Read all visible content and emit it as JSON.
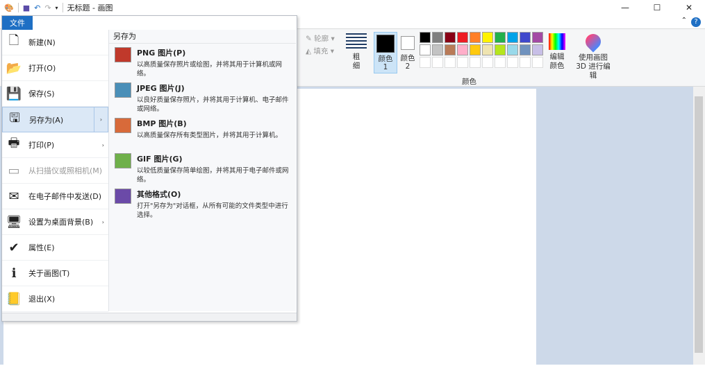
{
  "title": "无标题 - 画图",
  "file_tab": "文件",
  "left_menu": [
    {
      "label": "新建(N)",
      "icon": "new-file-icon",
      "glyph": "🗋"
    },
    {
      "label": "打开(O)",
      "icon": "open-folder-icon",
      "glyph": "📂"
    },
    {
      "label": "保存(S)",
      "icon": "save-icon",
      "glyph": "💾"
    },
    {
      "label": "另存为(A)",
      "icon": "save-as-icon",
      "glyph": "🖫",
      "arrow": "›"
    },
    {
      "label": "打印(P)",
      "icon": "printer-icon",
      "glyph": "🖶",
      "arrow": "›"
    },
    {
      "label": "从扫描仪或照相机(M)",
      "icon": "scanner-icon",
      "glyph": "▭"
    },
    {
      "label": "在电子邮件中发送(D)",
      "icon": "email-icon",
      "glyph": "✉"
    },
    {
      "label": "设置为桌面背景(B)",
      "icon": "desktop-background-icon",
      "glyph": "🖥",
      "arrow": "›"
    },
    {
      "label": "属性(E)",
      "icon": "checkmark-icon",
      "glyph": "✔"
    },
    {
      "label": "关于画图(T)",
      "icon": "info-icon",
      "glyph": "ℹ"
    },
    {
      "label": "退出(X)",
      "icon": "exit-icon",
      "glyph": "📒"
    }
  ],
  "save_as": {
    "header": "另存为",
    "items": [
      {
        "title": "PNG 图片(P)",
        "desc": "以高质量保存照片或绘图，并将其用于计算机或网络。",
        "color": "#c0392b"
      },
      {
        "title": "JPEG 图片(J)",
        "desc": "以良好质量保存照片，并将其用于计算机、电子邮件或网络。",
        "color": "#4a8fb8"
      },
      {
        "title": "BMP 图片(B)",
        "desc": "以高质量保存所有类型图片，并将其用于计算机。",
        "color": "#d86a3a"
      },
      {
        "title": "GIF 图片(G)",
        "desc": "以较低质量保存简单绘图，并将其用于电子邮件或网络。",
        "color": "#6fb04a"
      },
      {
        "title": "其他格式(O)",
        "desc": "打开\"另存为\"对话框，从所有可能的文件类型中进行选择。",
        "color": "#6b4aa8"
      }
    ]
  },
  "ribbon": {
    "outline": "轮廓",
    "fill": "填充",
    "size": "粗细",
    "color1": "颜色 1",
    "color2": "颜色 2",
    "colors_group": "颜色",
    "edit_colors": "编辑颜色",
    "paint3d": "使用画图 3D 进行编辑"
  },
  "palette": [
    "#000000",
    "#7f7f7f",
    "#880015",
    "#ed1c24",
    "#ff7f27",
    "#fff200",
    "#22b14c",
    "#00a2e8",
    "#3f48cc",
    "#a349a4",
    "#ffffff",
    "#c3c3c3",
    "#b97a57",
    "#ffaec9",
    "#ffc90e",
    "#efe4b0",
    "#b5e61d",
    "#99d9ea",
    "#7092be",
    "#c8bfe7",
    "#ffffff",
    "#ffffff",
    "#ffffff",
    "#ffffff",
    "#ffffff",
    "#ffffff",
    "#ffffff",
    "#ffffff",
    "#ffffff",
    "#ffffff"
  ]
}
